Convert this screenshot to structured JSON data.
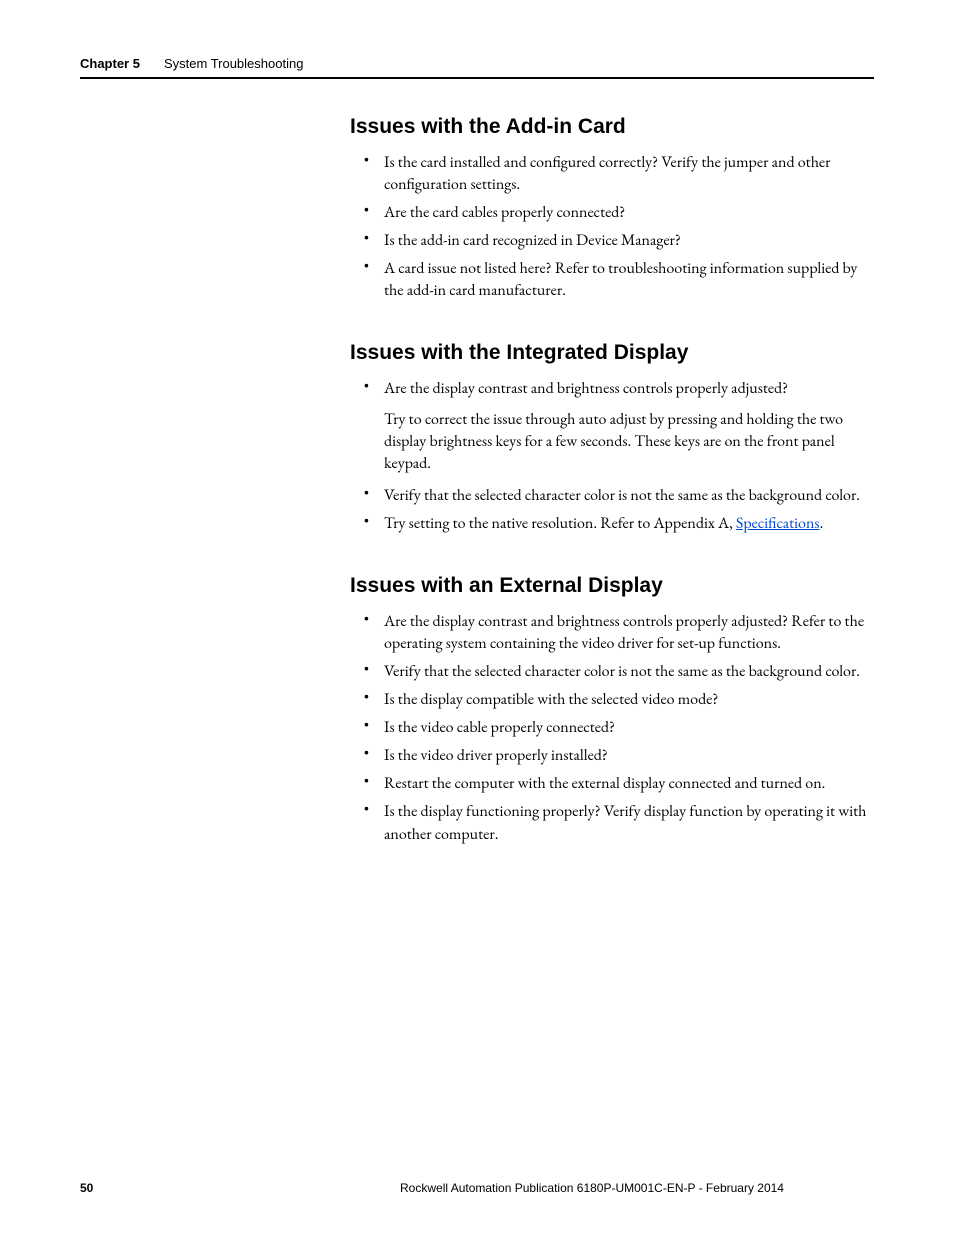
{
  "header": {
    "chapter_label": "Chapter 5",
    "chapter_title": "System Troubleshooting"
  },
  "sections": [
    {
      "heading": "Issues with the Add-in Card",
      "items": [
        {
          "text": "Is the card installed and configured correctly? Verify the jumper and other configuration settings."
        },
        {
          "text": "Are the card cables properly connected?"
        },
        {
          "text": "Is the add-in card recognized in Device Manager?"
        },
        {
          "text": "A card issue not listed here? Refer to troubleshooting information supplied by the add-in card manufacturer."
        }
      ]
    },
    {
      "heading": "Issues with the Integrated Display",
      "items": [
        {
          "text": "Are the display contrast and brightness controls properly adjusted?",
          "subpara": "Try to correct the issue through auto adjust by pressing and holding the two display brightness keys for a few seconds. These keys are on the front panel keypad."
        },
        {
          "text": "Verify that the selected character color is not the same as the background color."
        },
        {
          "text_pre": "Try setting to the native resolution. Refer to Appendix A, ",
          "link_text": "Specifications",
          "text_post": "."
        }
      ]
    },
    {
      "heading": "Issues with an External Display",
      "items": [
        {
          "text": "Are the display contrast and brightness controls properly adjusted? Refer to the operating system containing the video driver for set-up functions."
        },
        {
          "text": "Verify that the selected character color is not the same as the background color."
        },
        {
          "text": "Is the display compatible with the selected video mode?"
        },
        {
          "text": "Is the video cable properly connected?"
        },
        {
          "text": "Is the video driver properly installed?"
        },
        {
          "text": "Restart the computer with the external display connected and turned on."
        },
        {
          "text": "Is the display functioning properly? Verify display function by operating it with another computer."
        }
      ]
    }
  ],
  "footer": {
    "page_number": "50",
    "publication": "Rockwell Automation Publication 6180P-UM001C-EN-P - February 2014"
  }
}
